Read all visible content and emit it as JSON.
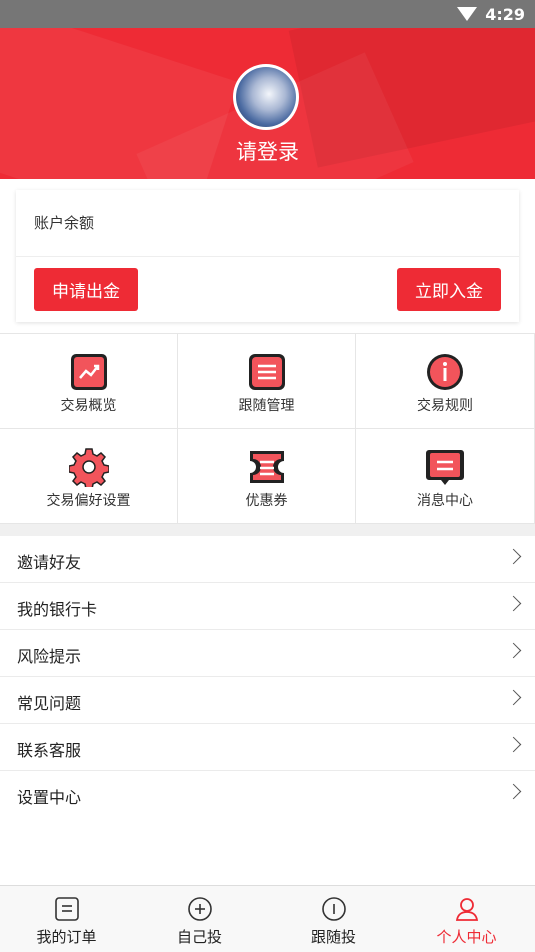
{
  "status_bar": {
    "time": "4:29"
  },
  "header": {
    "login_text": "请登录"
  },
  "balance": {
    "label": "账户余额",
    "withdraw_label": "申请出金",
    "deposit_label": "立即入金"
  },
  "grid": [
    {
      "label": "交易概览",
      "icon": "trend-chart-icon"
    },
    {
      "label": "跟随管理",
      "icon": "list-document-icon"
    },
    {
      "label": "交易规则",
      "icon": "info-icon"
    },
    {
      "label": "交易偏好设置",
      "icon": "gear-icon"
    },
    {
      "label": "优惠券",
      "icon": "coupon-icon"
    },
    {
      "label": "消息中心",
      "icon": "message-icon"
    }
  ],
  "menu": [
    {
      "label": "邀请好友"
    },
    {
      "label": "我的银行卡"
    },
    {
      "label": "风险提示"
    },
    {
      "label": "常见问题"
    },
    {
      "label": "联系客服"
    },
    {
      "label": "设置中心"
    }
  ],
  "tabs": [
    {
      "label": "我的订单",
      "icon": "order-list-icon"
    },
    {
      "label": "自己投",
      "icon": "plus-circle-icon"
    },
    {
      "label": "跟随投",
      "icon": "follow-circle-icon"
    },
    {
      "label": "个人中心",
      "icon": "person-icon",
      "active": true
    }
  ],
  "colors": {
    "accent": "#ee2b35",
    "status_bar": "#767676"
  }
}
